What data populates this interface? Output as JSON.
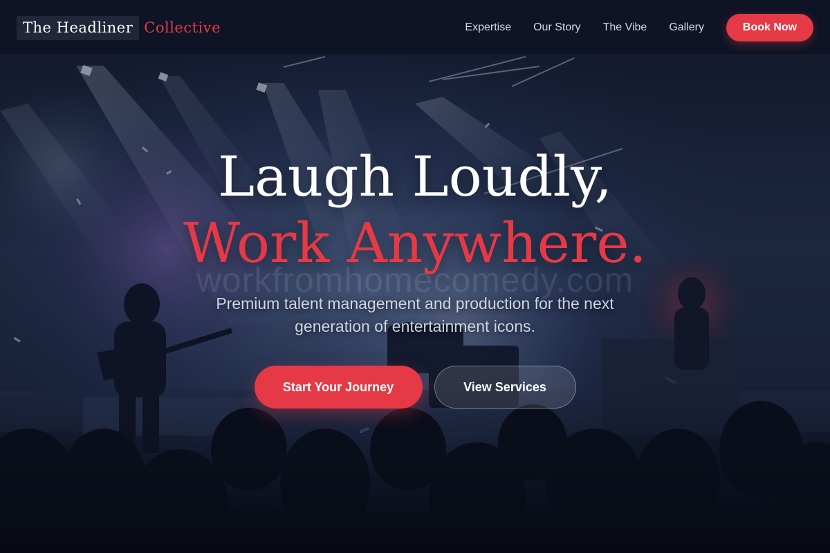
{
  "header": {
    "logo_main": "The Headliner",
    "logo_accent": "Collective",
    "nav": [
      {
        "label": "Expertise"
      },
      {
        "label": "Our Story"
      },
      {
        "label": "The Vibe"
      },
      {
        "label": "Gallery"
      }
    ],
    "book_button": "Book Now"
  },
  "hero": {
    "headline_line1": "Laugh Loudly,",
    "headline_line2": "Work Anywhere.",
    "watermark": "workfromhomecomedy.com",
    "subheadline": "Premium talent management and production for the next generation of entertainment icons.",
    "primary_cta": "Start Your Journey",
    "secondary_cta": "View Services",
    "background_image": "concert-stage-photo"
  },
  "colors": {
    "accent": "#e63946",
    "header_bg": "#0e1426",
    "text_light": "#cfd4e0"
  }
}
